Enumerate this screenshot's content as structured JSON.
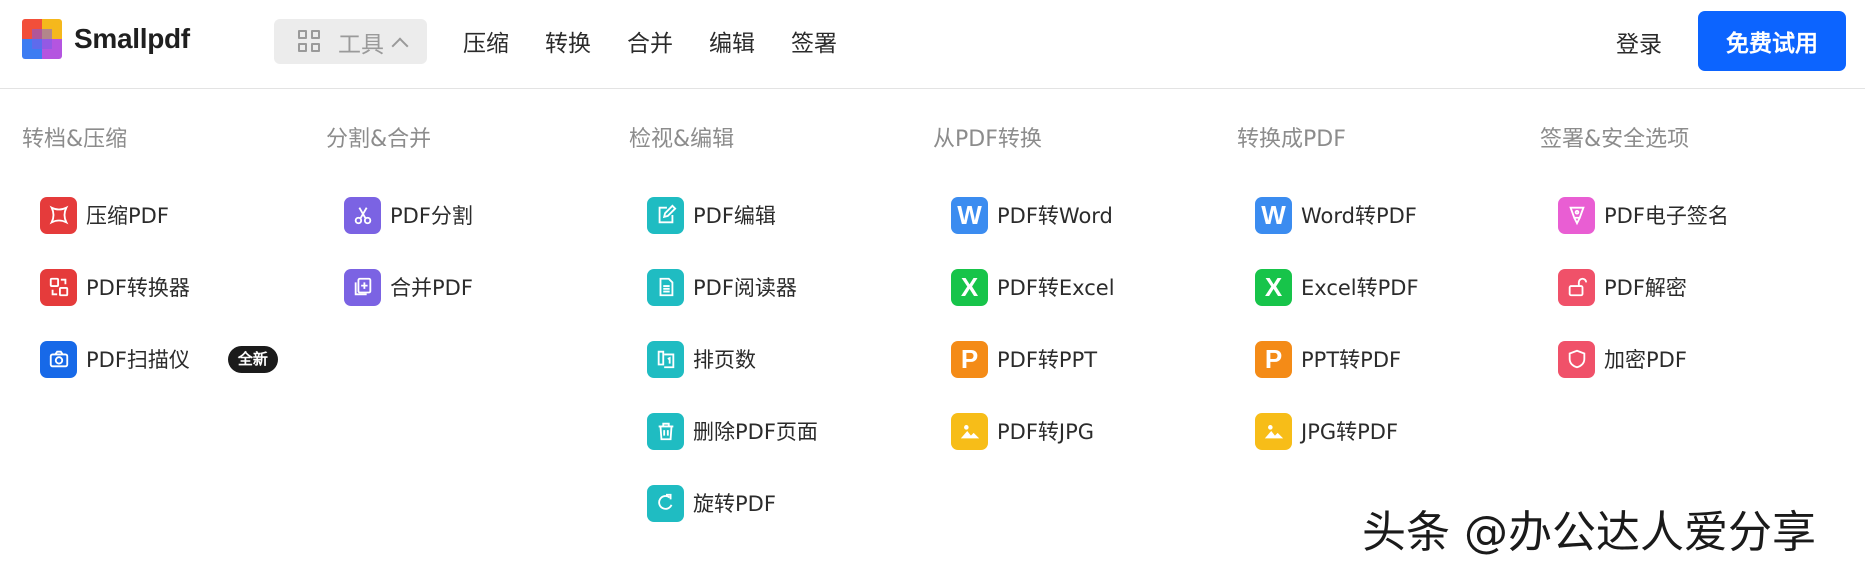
{
  "header": {
    "brand": "Smallpdf",
    "tools_label": "工具",
    "nav": [
      "压缩",
      "转换",
      "合并",
      "编辑",
      "签署"
    ],
    "login_label": "登录",
    "trial_label": "免费试用",
    "accent_color": "#0c64ff"
  },
  "menu": {
    "columns": [
      {
        "title": "转档&压缩",
        "items": [
          {
            "label": "压缩PDF",
            "icon": "compress-icon",
            "color": "#e53b3b"
          },
          {
            "label": "PDF转换器",
            "icon": "convert-icon",
            "color": "#e53b3b"
          },
          {
            "label": "PDF扫描仪",
            "icon": "camera-icon",
            "color": "#1769e8",
            "badge": "全新"
          }
        ]
      },
      {
        "title": "分割&合并",
        "items": [
          {
            "label": "PDF分割",
            "icon": "scissors-icon",
            "color": "#7b63e3"
          },
          {
            "label": "合并PDF",
            "icon": "merge-icon",
            "color": "#7b63e3"
          }
        ]
      },
      {
        "title": "检视&编辑",
        "items": [
          {
            "label": "PDF编辑",
            "icon": "edit-icon",
            "color": "#1fbcc2"
          },
          {
            "label": "PDF阅读器",
            "icon": "reader-icon",
            "color": "#1fbcc2"
          },
          {
            "label": "排页数",
            "icon": "page-number-icon",
            "color": "#1fbcc2"
          },
          {
            "label": "删除PDF页面",
            "icon": "trash-icon",
            "color": "#1fbcc2"
          },
          {
            "label": "旋转PDF",
            "icon": "rotate-icon",
            "color": "#1fbcc2"
          }
        ]
      },
      {
        "title": "从PDF转换",
        "items": [
          {
            "label": "PDF转Word",
            "icon": "word-icon",
            "color": "#3b8cf0",
            "letter": "W"
          },
          {
            "label": "PDF转Excel",
            "icon": "excel-icon",
            "color": "#17c44a",
            "letter": "X"
          },
          {
            "label": "PDF转PPT",
            "icon": "ppt-icon",
            "color": "#f48b17",
            "letter": "P"
          },
          {
            "label": "PDF转JPG",
            "icon": "jpg-icon",
            "color": "#f7bd18"
          }
        ]
      },
      {
        "title": "转换成PDF",
        "items": [
          {
            "label": "Word转PDF",
            "icon": "word-icon",
            "color": "#3b8cf0",
            "letter": "W"
          },
          {
            "label": "Excel转PDF",
            "icon": "excel-icon",
            "color": "#17c44a",
            "letter": "X"
          },
          {
            "label": "PPT转PDF",
            "icon": "ppt-icon",
            "color": "#f48b17",
            "letter": "P"
          },
          {
            "label": "JPG转PDF",
            "icon": "jpg-icon",
            "color": "#f7bd18"
          }
        ]
      },
      {
        "title": "签署&安全选项",
        "items": [
          {
            "label": "PDF电子签名",
            "icon": "pen-icon",
            "color": "#e95ed3"
          },
          {
            "label": "PDF解密",
            "icon": "unlock-icon",
            "color": "#f05169"
          },
          {
            "label": "加密PDF",
            "icon": "shield-icon",
            "color": "#f05169"
          }
        ]
      }
    ]
  },
  "watermark": "头条 @办公达人爱分享"
}
